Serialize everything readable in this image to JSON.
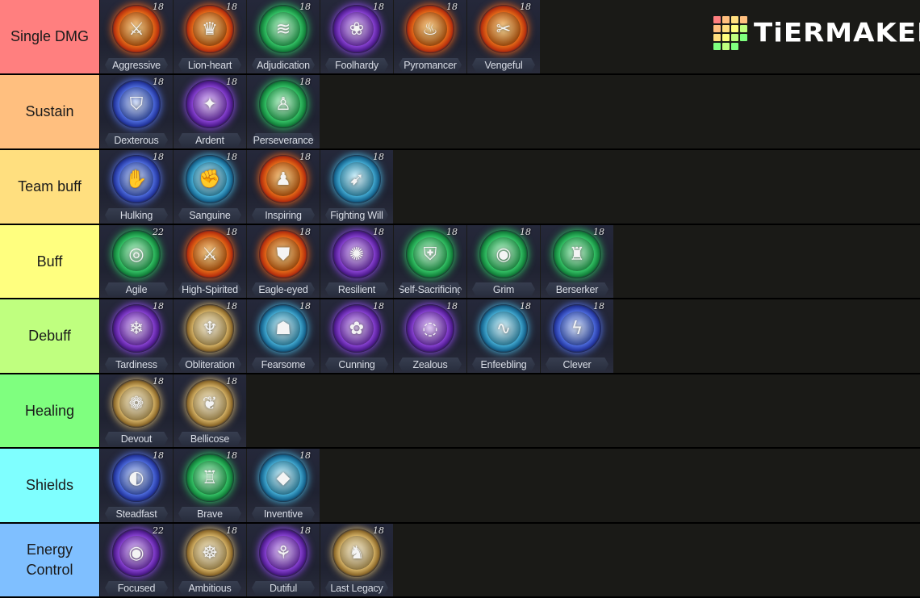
{
  "logo": {
    "text": "TiERMAKER",
    "grid_colors": [
      "#ff7f7f",
      "#ffbf7f",
      "#ffdf7f",
      "#ffbf7f",
      "#ffbf7f",
      "#ffdf7f",
      "#ffff7f",
      "#bfff7f",
      "#ffdf7f",
      "#ffff7f",
      "#bfff7f",
      "#7fff7f",
      "#7fff7f",
      "#bfff7f",
      "#7fff7f",
      "#1a1a17"
    ]
  },
  "tiers": [
    {
      "label": "Single DMG",
      "color": "#ff7f7f",
      "items": [
        {
          "name": "Aggressive",
          "level": "18",
          "theme": "fire",
          "icon": "sword-icon",
          "glyph": "⚔"
        },
        {
          "name": "Lion-heart",
          "level": "18",
          "theme": "fire",
          "icon": "crown-icon",
          "glyph": "♛"
        },
        {
          "name": "Adjudication",
          "level": "18",
          "theme": "green",
          "icon": "wind-icon",
          "glyph": "≋"
        },
        {
          "name": "Foolhardy",
          "level": "18",
          "theme": "purple",
          "icon": "creature-icon",
          "glyph": "❀"
        },
        {
          "name": "Pyromancer",
          "level": "18",
          "theme": "fire",
          "icon": "flame-icon",
          "glyph": "♨"
        },
        {
          "name": "Vengeful",
          "level": "18",
          "theme": "fire",
          "icon": "blade-icon",
          "glyph": "✂"
        }
      ]
    },
    {
      "label": "Sustain",
      "color": "#ffbf7f",
      "items": [
        {
          "name": "Dexterous",
          "level": "18",
          "theme": "blue",
          "icon": "shield-icon",
          "glyph": "⛉"
        },
        {
          "name": "Ardent",
          "level": "18",
          "theme": "purple",
          "icon": "crest-icon",
          "glyph": "✦"
        },
        {
          "name": "Perseverance",
          "level": "18",
          "theme": "green",
          "icon": "figure-icon",
          "glyph": "♙"
        }
      ]
    },
    {
      "label": "Team buff",
      "color": "#ffdf7f",
      "items": [
        {
          "name": "Hulking",
          "level": "18",
          "theme": "blue",
          "icon": "claw-icon",
          "glyph": "✋"
        },
        {
          "name": "Sanguine",
          "level": "18",
          "theme": "cyan",
          "icon": "fist-icon",
          "glyph": "✊"
        },
        {
          "name": "Inspiring",
          "level": "18",
          "theme": "fire",
          "icon": "rising-figure-icon",
          "glyph": "♟"
        },
        {
          "name": "Fighting Will",
          "level": "18",
          "theme": "cyan",
          "icon": "strike-icon",
          "glyph": "➹"
        }
      ]
    },
    {
      "label": "Buff",
      "color": "#ffff7f",
      "items": [
        {
          "name": "Agile",
          "level": "22",
          "theme": "green",
          "icon": "swirl-icon",
          "glyph": "◎"
        },
        {
          "name": "High-Spirited",
          "level": "18",
          "theme": "fire",
          "icon": "crossed-swords-icon",
          "glyph": "⚔"
        },
        {
          "name": "Eagle-eyed",
          "level": "18",
          "theme": "fire",
          "icon": "helm-icon",
          "glyph": "⛊"
        },
        {
          "name": "Resilient",
          "level": "18",
          "theme": "purple",
          "icon": "spiral-icon",
          "glyph": "✺"
        },
        {
          "name": "Self-Sacrificing",
          "level": "18",
          "theme": "green",
          "icon": "guard-shield-icon",
          "glyph": "⛨"
        },
        {
          "name": "Grim",
          "level": "18",
          "theme": "green",
          "icon": "target-icon",
          "glyph": "◉"
        },
        {
          "name": "Berserker",
          "level": "18",
          "theme": "green",
          "icon": "warrior-icon",
          "glyph": "♜"
        }
      ]
    },
    {
      "label": "Debuff",
      "color": "#bfff7f",
      "items": [
        {
          "name": "Tardiness",
          "level": "18",
          "theme": "purple",
          "icon": "snowflake-blade-icon",
          "glyph": "❄"
        },
        {
          "name": "Obliteration",
          "level": "18",
          "theme": "gold",
          "icon": "trident-icon",
          "glyph": "♆"
        },
        {
          "name": "Fearsome",
          "level": "18",
          "theme": "cyan",
          "icon": "beast-icon",
          "glyph": "☗"
        },
        {
          "name": "Cunning",
          "level": "18",
          "theme": "purple",
          "icon": "tentacle-icon",
          "glyph": "✿"
        },
        {
          "name": "Zealous",
          "level": "18",
          "theme": "purple",
          "icon": "vortex-icon",
          "glyph": "◌"
        },
        {
          "name": "Enfeebling",
          "level": "18",
          "theme": "cyan",
          "icon": "serpent-icon",
          "glyph": "∿"
        },
        {
          "name": "Clever",
          "level": "18",
          "theme": "blue",
          "icon": "lightning-icon",
          "glyph": "ϟ"
        }
      ]
    },
    {
      "label": "Healing",
      "color": "#7fff7f",
      "items": [
        {
          "name": "Devout",
          "level": "18",
          "theme": "gold",
          "icon": "lotus-icon",
          "glyph": "❁"
        },
        {
          "name": "Bellicose",
          "level": "18",
          "theme": "gold",
          "icon": "feather-icon",
          "glyph": "❦"
        }
      ]
    },
    {
      "label": "Shields",
      "color": "#7fffff",
      "items": [
        {
          "name": "Steadfast",
          "level": "18",
          "theme": "blue",
          "icon": "barrier-icon",
          "glyph": "◐"
        },
        {
          "name": "Brave",
          "level": "18",
          "theme": "green",
          "icon": "soldiers-icon",
          "glyph": "♖"
        },
        {
          "name": "Inventive",
          "level": "18",
          "theme": "cyan",
          "icon": "gem-icon",
          "glyph": "◆"
        }
      ]
    },
    {
      "label": "Energy Control",
      "color": "#7fbfff",
      "items": [
        {
          "name": "Focused",
          "level": "22",
          "theme": "purple",
          "icon": "eye-icon",
          "glyph": "◉"
        },
        {
          "name": "Ambitious",
          "level": "18",
          "theme": "gold",
          "icon": "wheel-icon",
          "glyph": "☸"
        },
        {
          "name": "Dutiful",
          "level": "18",
          "theme": "purple",
          "icon": "dancer-icon",
          "glyph": "⚘"
        },
        {
          "name": "Last Legacy",
          "level": "18",
          "theme": "gold",
          "icon": "titan-icon",
          "glyph": "♞"
        }
      ]
    }
  ]
}
